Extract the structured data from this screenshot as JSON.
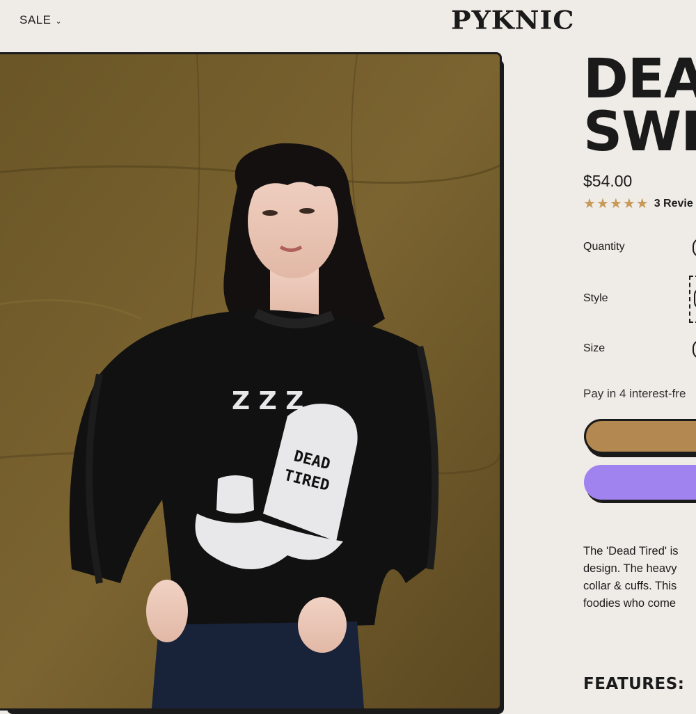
{
  "header": {
    "nav_prev_glyph": "‹",
    "sale_label": "SALE",
    "logo": "PYKNIC"
  },
  "product": {
    "title": "DEAD\nSWEATER",
    "title_visible": "DEA\nSWE",
    "price": "$54.00",
    "rating": 5,
    "reviews": "3 Revie",
    "image_alt": "Model wearing black Dead Tired knit sweater",
    "sweater_text": "DEAD TIRED",
    "zzz": "Z Z Z"
  },
  "options": {
    "quantity_label": "Quantity",
    "style_label": "Style",
    "size_label": "Size"
  },
  "payment": {
    "pay_in_text": "Pay in 4 interest-fre"
  },
  "description": {
    "lines": [
      "The 'Dead Tired' is",
      "design.  The heavy",
      "collar & cuffs. This",
      "foodies who come"
    ]
  },
  "features_heading": "FEATURES:",
  "colors": {
    "background": "#efece7",
    "add_to_cart": "#b48851",
    "pay_button": "#a083ef",
    "star": "#c79a5a",
    "ink": "#1a1a1a"
  }
}
